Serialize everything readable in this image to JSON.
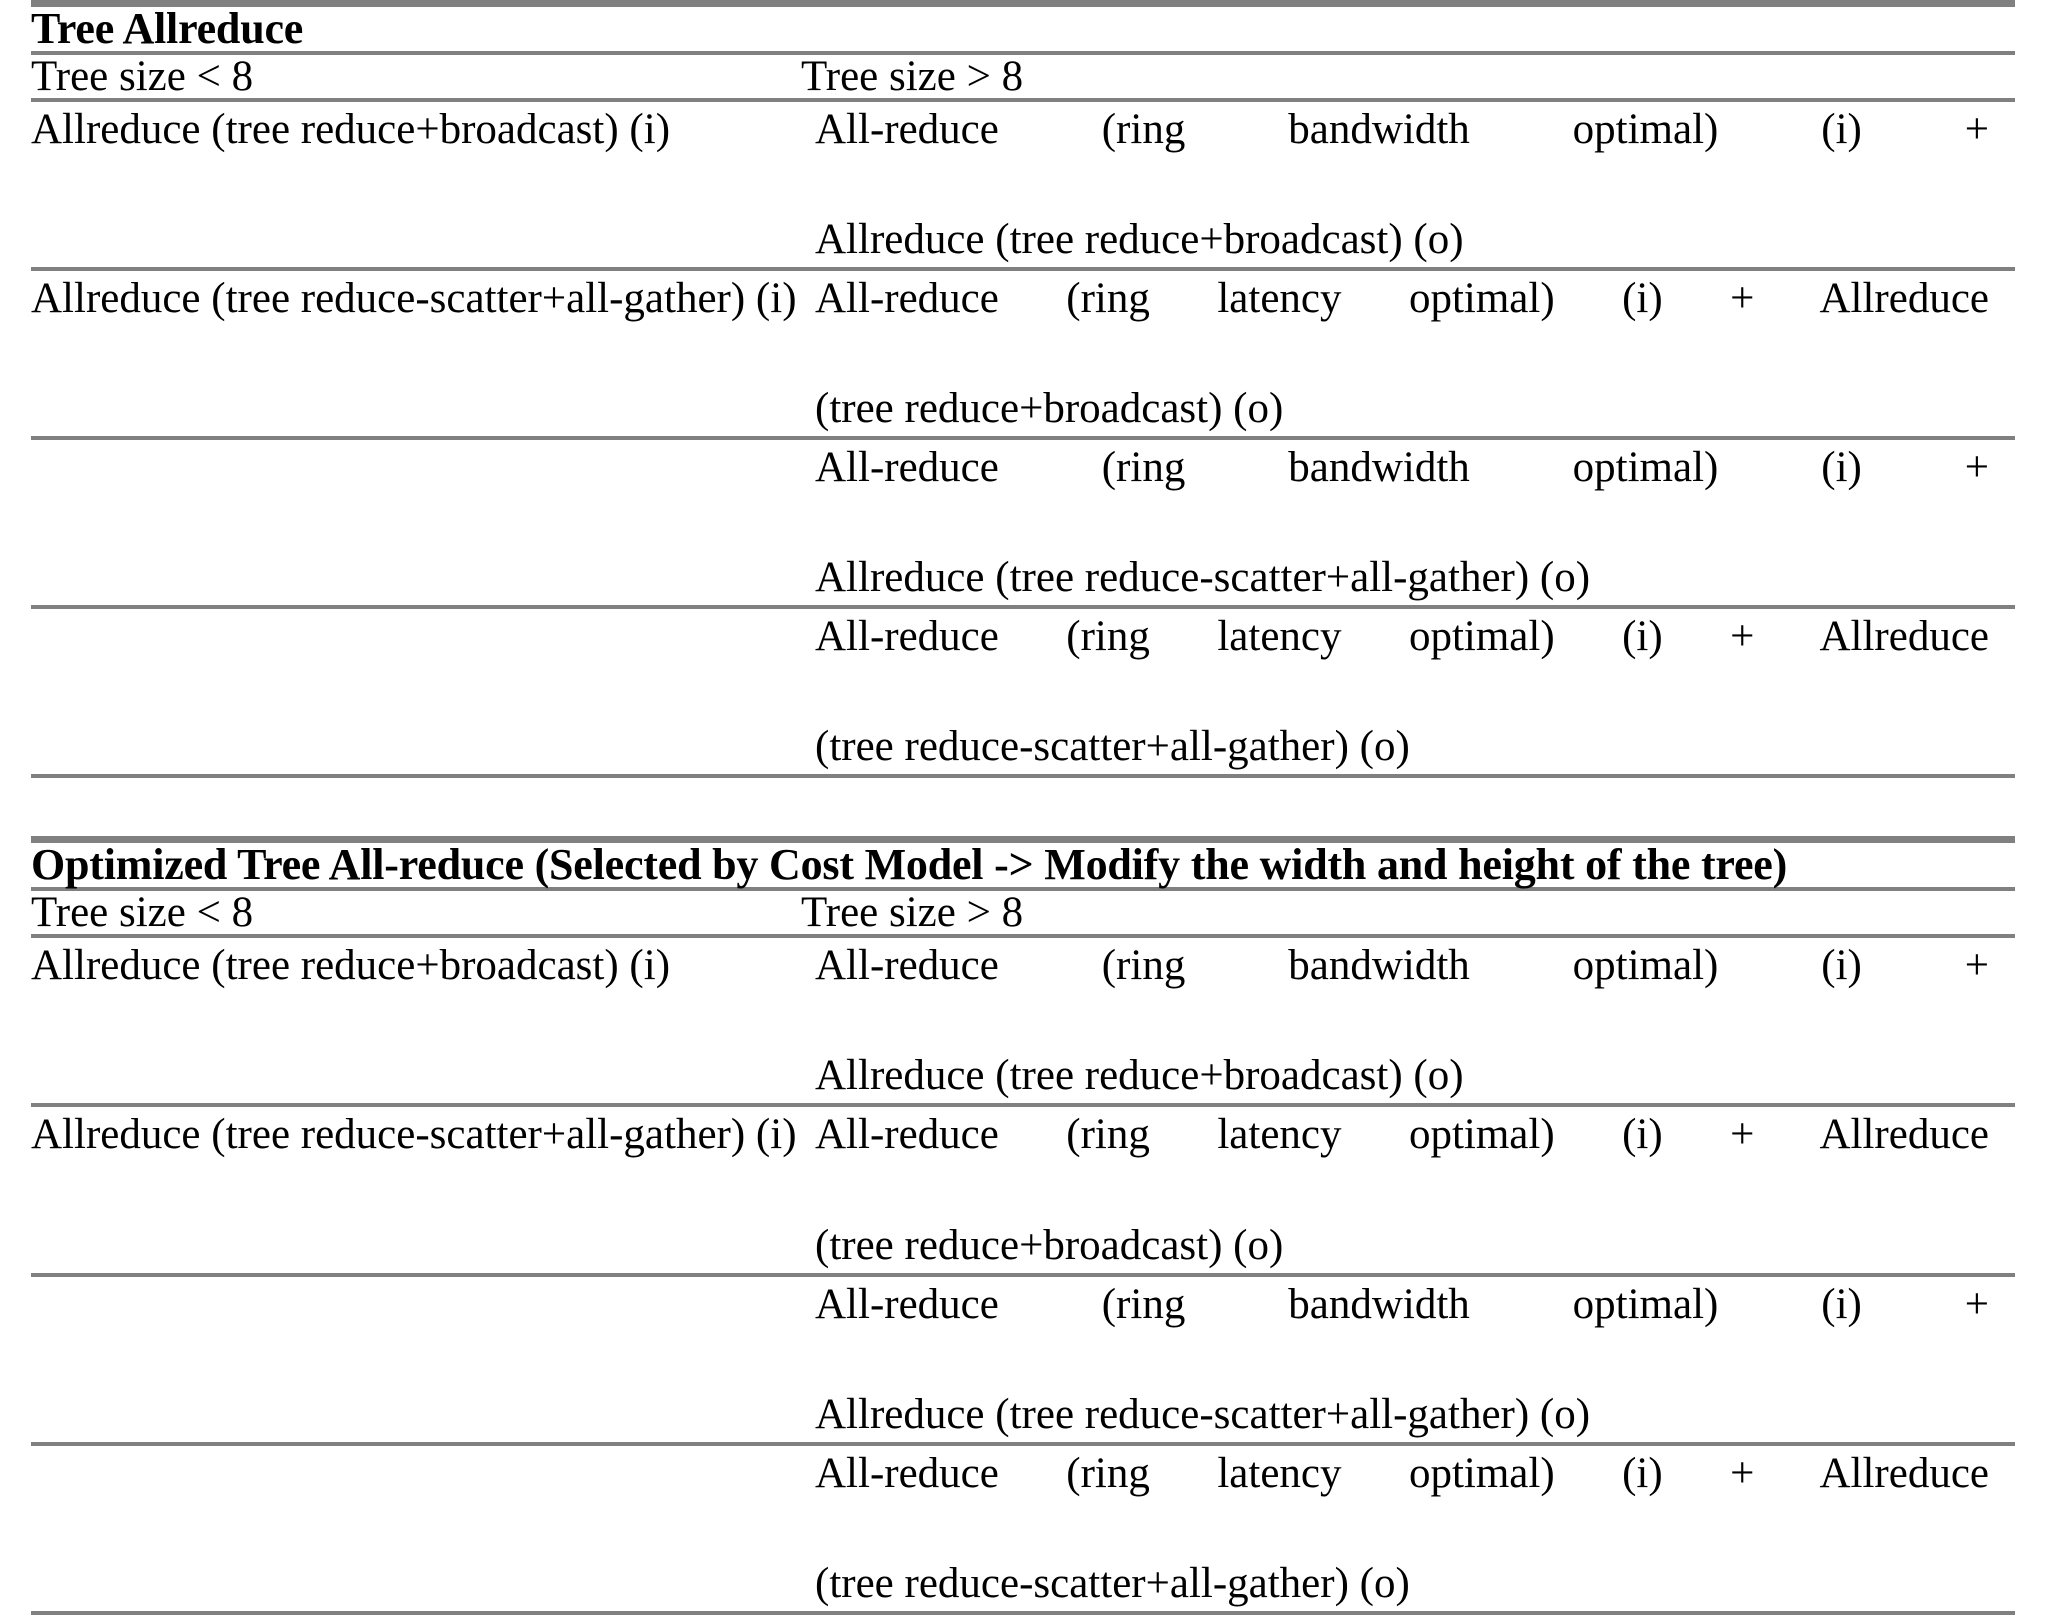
{
  "document": {
    "type": "two-stacked-tables",
    "rule_color": "#808080",
    "text_color": "#000000",
    "background": "#ffffff"
  },
  "tables": [
    {
      "title": "Tree Allreduce",
      "columns": [
        "Tree size < 8",
        "Tree size > 8"
      ],
      "rows": [
        {
          "left": "Allreduce (tree reduce+broadcast) (i)",
          "right_line1": "All-reduce (ring bandwidth optimal) (i) +",
          "right_line2": "Allreduce (tree reduce+broadcast) (o)"
        },
        {
          "left": "Allreduce (tree reduce-scatter+all-gather) (i)",
          "right_line1": "All-reduce (ring latency optimal) (i) + Allreduce",
          "right_line2": "(tree reduce+broadcast) (o)"
        },
        {
          "left": "",
          "right_line1": "All-reduce (ring bandwidth optimal) (i) +",
          "right_line2": "Allreduce (tree reduce-scatter+all-gather) (o)"
        },
        {
          "left": "",
          "right_line1": "All-reduce (ring latency optimal) (i) + Allreduce",
          "right_line2": "(tree reduce-scatter+all-gather) (o)"
        }
      ]
    },
    {
      "title": "Optimized Tree All-reduce (Selected by Cost Model -> Modify the width and height of the tree)",
      "columns": [
        "Tree size < 8",
        "Tree size > 8"
      ],
      "rows": [
        {
          "left": "Allreduce (tree reduce+broadcast) (i)",
          "right_line1": "All-reduce (ring bandwidth optimal) (i) +",
          "right_line2": "Allreduce (tree reduce+broadcast) (o)"
        },
        {
          "left": "Allreduce (tree reduce-scatter+all-gather) (i)",
          "right_line1": "All-reduce (ring latency optimal) (i) + Allreduce",
          "right_line2": "(tree reduce+broadcast) (o)"
        },
        {
          "left": "",
          "right_line1": "All-reduce (ring bandwidth optimal) (i) +",
          "right_line2": "Allreduce (tree reduce-scatter+all-gather) (o)"
        },
        {
          "left": "",
          "right_line1": "All-reduce (ring latency optimal) (i) + Allreduce",
          "right_line2": "(tree reduce-scatter+all-gather) (o)"
        }
      ]
    }
  ]
}
